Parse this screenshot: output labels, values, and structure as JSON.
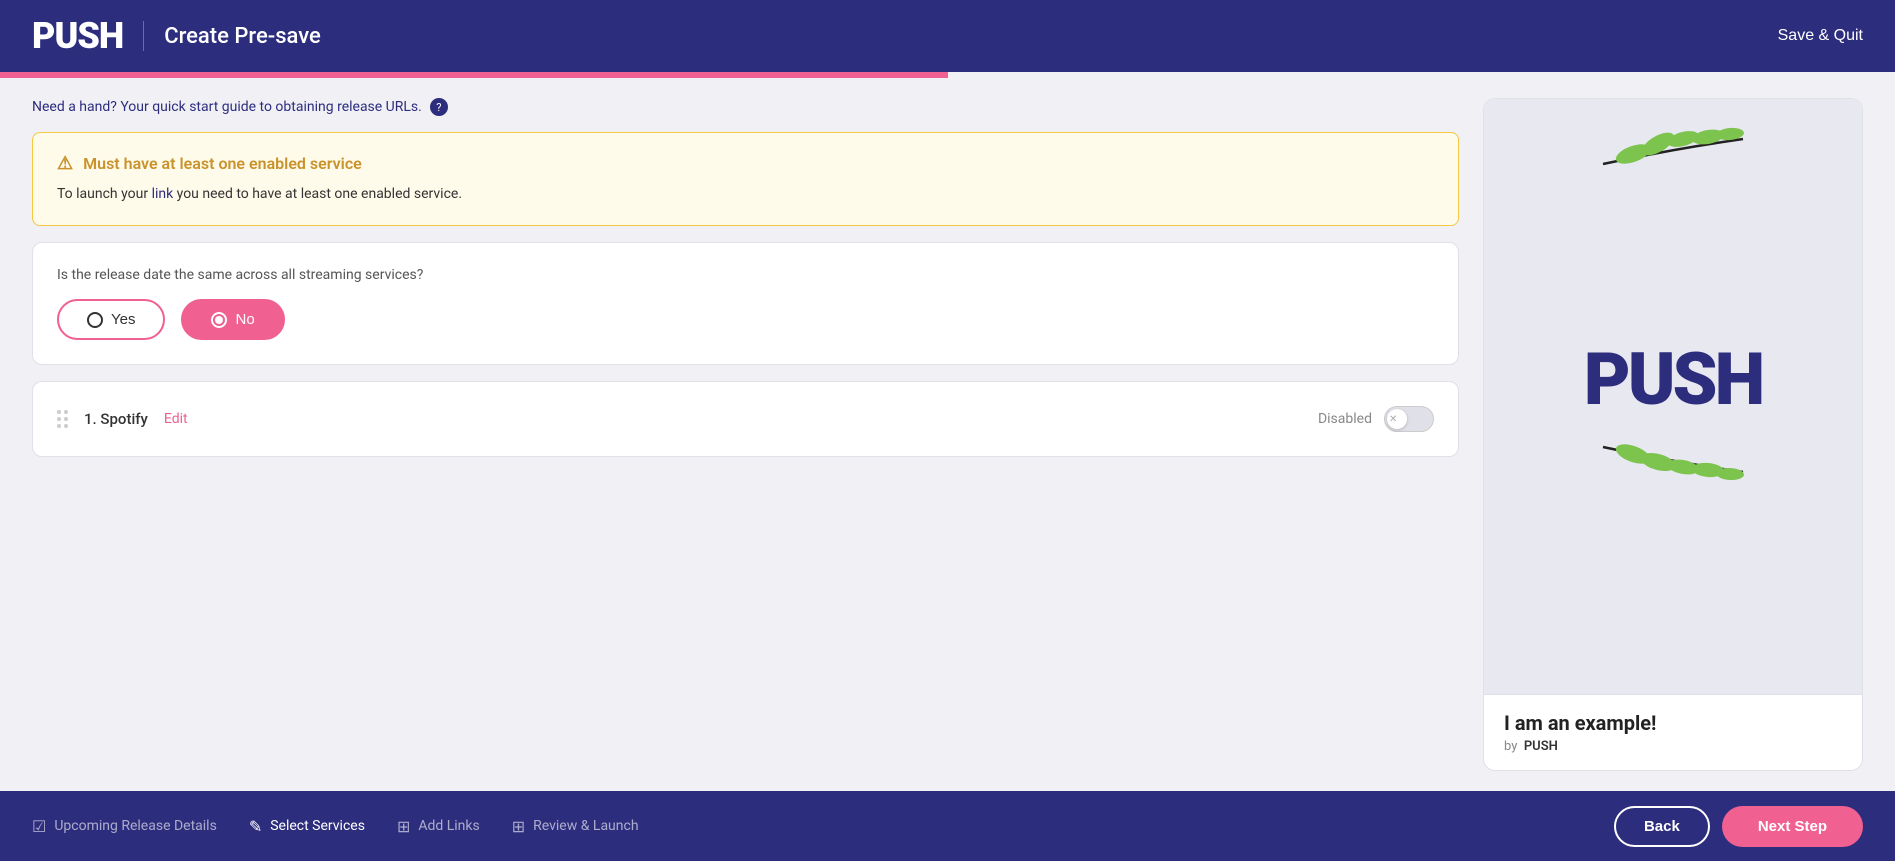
{
  "header": {
    "logo": "PUSH",
    "title": "Create Pre-save",
    "save_quit": "Save & Quit"
  },
  "help": {
    "text": "Need a hand? Your quick start guide to obtaining release URLs.",
    "icon": "?"
  },
  "warning": {
    "title": "Must have at least one enabled service",
    "description": "To launch your link you need to have at least one enabled service.",
    "link_text": "link"
  },
  "question": {
    "text": "Is the release date the same across all streaming services?"
  },
  "radio_options": {
    "yes": "Yes",
    "no": "No"
  },
  "services": [
    {
      "number": "1.",
      "name": "Spotify",
      "edit_label": "Edit",
      "status": "Disabled"
    }
  ],
  "preview": {
    "logo": "PUSH",
    "title": "I am an example!",
    "subtitle_by": "by",
    "subtitle_name": "PUSH"
  },
  "footer": {
    "steps": [
      {
        "label": "Upcoming Release Details",
        "icon": "✓",
        "active": false
      },
      {
        "label": "Select Services",
        "icon": "✎",
        "active": true
      },
      {
        "label": "Add Links",
        "icon": "⬜",
        "active": false
      },
      {
        "label": "Review & Launch",
        "icon": "⬜",
        "active": false
      }
    ],
    "back_label": "Back",
    "next_label": "Next Step"
  },
  "colors": {
    "primary": "#2d2d7e",
    "accent": "#f06090",
    "warning_bg": "#fffbea",
    "warning_border": "#f5c842",
    "warning_text": "#c9922a"
  }
}
